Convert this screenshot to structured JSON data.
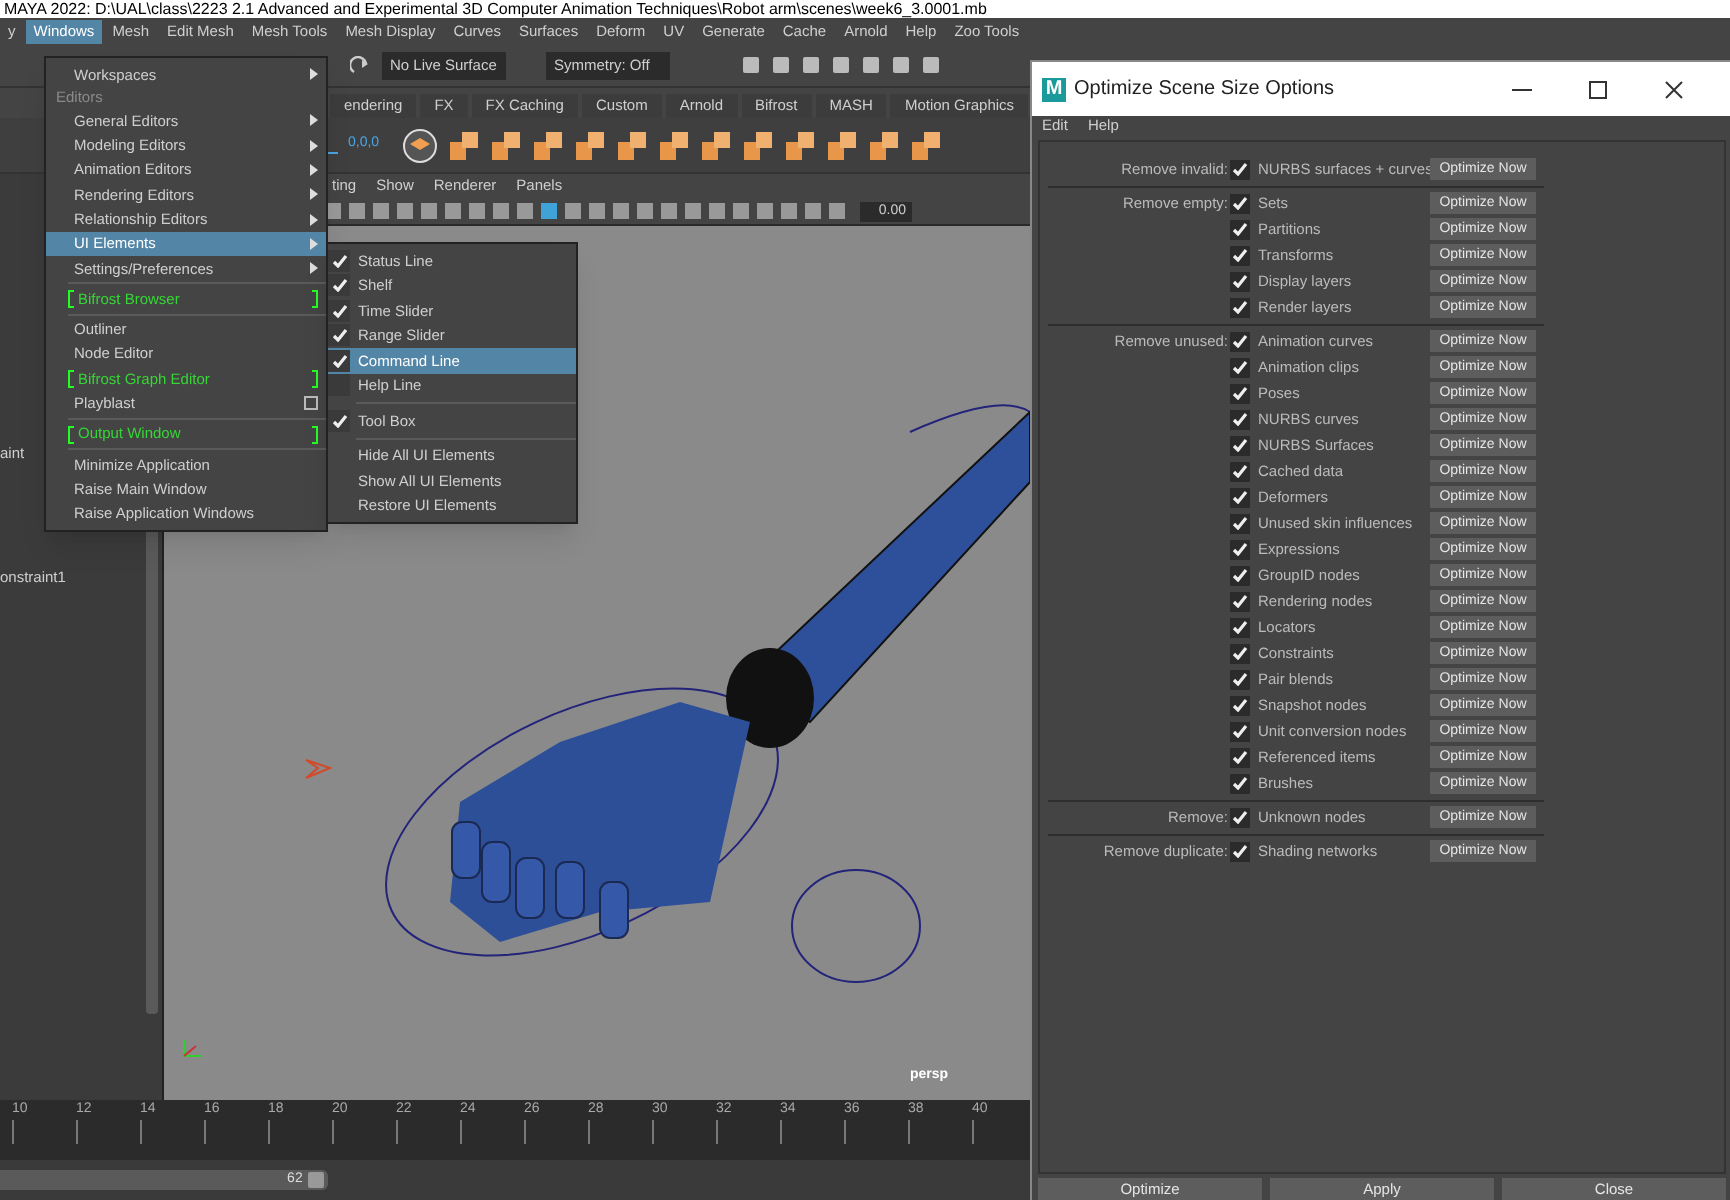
{
  "title_bar": {
    "text": "MAYA 2022: D:\\UAL\\class\\2223 2.1 Advanced and Experimental 3D Computer Animation Techniques\\Robot arm\\scenes\\week6_3.0001.mb"
  },
  "menu_bar": [
    {
      "label": "y",
      "selected": false
    },
    {
      "label": "Windows",
      "selected": true
    },
    {
      "label": "Mesh",
      "selected": false
    },
    {
      "label": "Edit Mesh",
      "selected": false
    },
    {
      "label": "Mesh Tools",
      "selected": false
    },
    {
      "label": "Mesh Display",
      "selected": false
    },
    {
      "label": "Curves",
      "selected": false
    },
    {
      "label": "Surfaces",
      "selected": false
    },
    {
      "label": "Deform",
      "selected": false
    },
    {
      "label": "UV",
      "selected": false
    },
    {
      "label": "Generate",
      "selected": false
    },
    {
      "label": "Cache",
      "selected": false
    },
    {
      "label": "Arnold",
      "selected": false
    },
    {
      "label": "Help",
      "selected": false
    },
    {
      "label": "Zoo Tools",
      "selected": false
    }
  ],
  "status_line": {
    "live_surface": "No Live Surface",
    "symmetry": "Symmetry: Off"
  },
  "shelf_tabs": [
    "endering",
    "FX",
    "FX Caching",
    "Custom",
    "Arnold",
    "Bifrost",
    "MASH",
    "Motion Graphics"
  ],
  "shelf": {
    "icon_text": "0,0,0"
  },
  "panel_menu": [
    "ting",
    "Show",
    "Renderer",
    "Panels"
  ],
  "viewport": {
    "exposure_value": "0.00",
    "camera_label": "persp"
  },
  "outliner": [
    "aint",
    "onstraint1"
  ],
  "windows_menu": [
    {
      "kind": "submenu",
      "label": "Workspaces",
      "selected": false
    },
    {
      "kind": "section",
      "label": "Editors"
    },
    {
      "kind": "submenu",
      "label": "General Editors",
      "selected": false
    },
    {
      "kind": "submenu",
      "label": "Modeling Editors",
      "selected": false
    },
    {
      "kind": "submenu",
      "label": "Animation Editors",
      "selected": false
    },
    {
      "kind": "submenu",
      "label": "Rendering Editors",
      "selected": false
    },
    {
      "kind": "submenu",
      "label": "Relationship Editors",
      "selected": false
    },
    {
      "kind": "submenu",
      "label": "UI Elements",
      "selected": true
    },
    {
      "kind": "submenu",
      "label": "Settings/Preferences",
      "selected": false
    },
    {
      "kind": "divider"
    },
    {
      "kind": "bifrost",
      "label": "Bifrost Browser",
      "selected": false
    },
    {
      "kind": "divider"
    },
    {
      "kind": "item",
      "label": "Outliner",
      "selected": false
    },
    {
      "kind": "item",
      "label": "Node Editor",
      "selected": false
    },
    {
      "kind": "bifrost",
      "label": "Bifrost Graph Editor",
      "selected": false
    },
    {
      "kind": "option",
      "label": "Playblast",
      "selected": false
    },
    {
      "kind": "divider"
    },
    {
      "kind": "bifrost",
      "label": "Output Window",
      "selected": false
    },
    {
      "kind": "divider"
    },
    {
      "kind": "item",
      "label": "Minimize Application",
      "selected": false
    },
    {
      "kind": "item",
      "label": "Raise Main Window",
      "selected": false
    },
    {
      "kind": "item",
      "label": "Raise Application Windows",
      "selected": false
    }
  ],
  "ui_elements_menu": [
    {
      "kind": "check",
      "label": "Status Line",
      "checked": true,
      "selected": false
    },
    {
      "kind": "check",
      "label": "Shelf",
      "checked": true,
      "selected": false
    },
    {
      "kind": "check",
      "label": "Time Slider",
      "checked": true,
      "selected": false
    },
    {
      "kind": "check",
      "label": "Range Slider",
      "checked": true,
      "selected": false
    },
    {
      "kind": "check",
      "label": "Command Line",
      "checked": true,
      "selected": true
    },
    {
      "kind": "check",
      "label": "Help Line",
      "checked": false,
      "selected": false
    },
    {
      "kind": "divider"
    },
    {
      "kind": "check",
      "label": "Tool Box",
      "checked": true,
      "selected": false
    },
    {
      "kind": "divider"
    },
    {
      "kind": "item",
      "label": "Hide All UI Elements",
      "selected": false
    },
    {
      "kind": "item",
      "label": "Show All UI Elements",
      "selected": false
    },
    {
      "kind": "item",
      "label": "Restore UI Elements",
      "selected": false
    }
  ],
  "dialog": {
    "logo_text": "M",
    "title": "Optimize Scene Size Options",
    "menu": [
      "Edit",
      "Help"
    ],
    "groups": [
      {
        "label": "Remove invalid:",
        "rows": [
          {
            "label": "NURBS surfaces + curves",
            "checked": true,
            "button": "Optimize Now"
          }
        ]
      },
      {
        "label": "Remove empty:",
        "rows": [
          {
            "label": "Sets",
            "checked": true,
            "button": "Optimize Now"
          },
          {
            "label": "Partitions",
            "checked": true,
            "button": "Optimize Now"
          },
          {
            "label": "Transforms",
            "checked": true,
            "button": "Optimize Now"
          },
          {
            "label": "Display layers",
            "checked": true,
            "button": "Optimize Now"
          },
          {
            "label": "Render layers",
            "checked": true,
            "button": "Optimize Now"
          }
        ]
      },
      {
        "label": "Remove unused:",
        "rows": [
          {
            "label": "Animation curves",
            "checked": true,
            "button": "Optimize Now"
          },
          {
            "label": "Animation clips",
            "checked": true,
            "button": "Optimize Now"
          },
          {
            "label": "Poses",
            "checked": true,
            "button": "Optimize Now"
          },
          {
            "label": "NURBS curves",
            "checked": true,
            "button": "Optimize Now"
          },
          {
            "label": "NURBS Surfaces",
            "checked": true,
            "button": "Optimize Now"
          },
          {
            "label": "Cached data",
            "checked": true,
            "button": "Optimize Now"
          },
          {
            "label": "Deformers",
            "checked": true,
            "button": "Optimize Now"
          },
          {
            "label": "Unused skin influences",
            "checked": true,
            "button": "Optimize Now"
          },
          {
            "label": "Expressions",
            "checked": true,
            "button": "Optimize Now"
          },
          {
            "label": "GroupID nodes",
            "checked": true,
            "button": "Optimize Now"
          },
          {
            "label": "Rendering nodes",
            "checked": true,
            "button": "Optimize Now"
          },
          {
            "label": "Locators",
            "checked": true,
            "button": "Optimize Now"
          },
          {
            "label": "Constraints",
            "checked": true,
            "button": "Optimize Now"
          },
          {
            "label": "Pair blends",
            "checked": true,
            "button": "Optimize Now"
          },
          {
            "label": "Snapshot nodes",
            "checked": true,
            "button": "Optimize Now"
          },
          {
            "label": "Unit conversion nodes",
            "checked": true,
            "button": "Optimize Now"
          },
          {
            "label": "Referenced items",
            "checked": true,
            "button": "Optimize Now"
          },
          {
            "label": "Brushes",
            "checked": true,
            "button": "Optimize Now"
          }
        ]
      },
      {
        "label": "Remove:",
        "rows": [
          {
            "label": "Unknown nodes",
            "checked": true,
            "button": "Optimize Now"
          }
        ]
      },
      {
        "label": "Remove duplicate:",
        "rows": [
          {
            "label": "Shading networks",
            "checked": true,
            "button": "Optimize Now"
          }
        ]
      }
    ],
    "buttons": [
      "Optimize",
      "Apply",
      "Close"
    ]
  },
  "timeline": {
    "ticks": [
      "10",
      "12",
      "14",
      "16",
      "18",
      "20",
      "22",
      "24",
      "26",
      "28",
      "30",
      "32",
      "34",
      "36",
      "38",
      "40"
    ],
    "range_end": "62",
    "level": 0.19
  }
}
